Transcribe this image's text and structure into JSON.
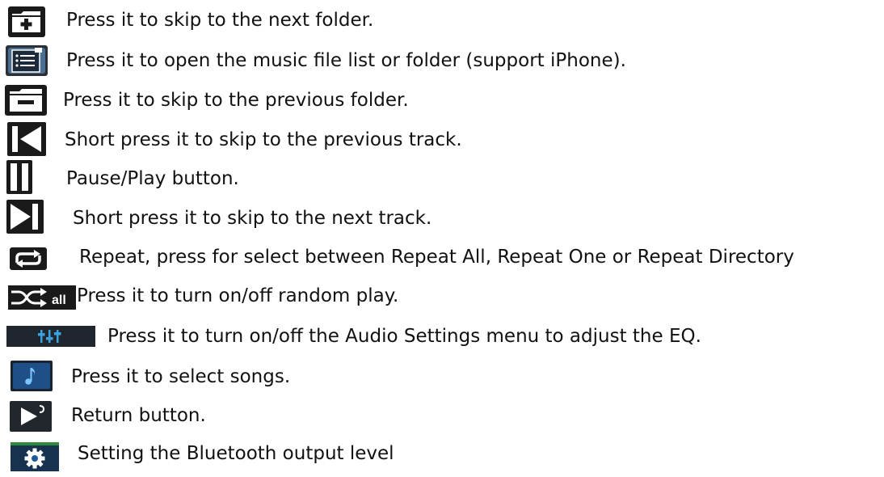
{
  "rows": [
    {
      "icon": "next-folder-icon",
      "text": "Press it to skip to the next folder."
    },
    {
      "icon": "file-list-icon",
      "text": "Press it to open the music file list or folder (support iPhone)."
    },
    {
      "icon": "previous-folder-icon",
      "text": "Press it to skip to the previous folder."
    },
    {
      "icon": "previous-track-icon",
      "text": "Short press it to skip to the previous track."
    },
    {
      "icon": "pause-play-icon",
      "text": "Pause/Play button."
    },
    {
      "icon": "next-track-icon",
      "text": "Short press it to skip to the next track."
    },
    {
      "icon": "repeat-icon",
      "text": "Repeat, press for select between Repeat All, Repeat One or Repeat Directory"
    },
    {
      "icon": "shuffle-all-icon",
      "icon_label": "all",
      "text": "Press it to turn on/off random play."
    },
    {
      "icon": "equalizer-icon",
      "text": "Press it to turn on/off the Audio Settings menu to adjust the EQ."
    },
    {
      "icon": "music-note-icon",
      "text": "Press it to select songs."
    },
    {
      "icon": "return-icon",
      "text": "Return button."
    },
    {
      "icon": "settings-gear-icon",
      "text": "Setting the Bluetooth output level"
    }
  ],
  "colors": {
    "icon_dark": "#1a1a1a",
    "icon_blue": "#1e4f86",
    "icon_accent": "#3aa2e0",
    "text": "#111111"
  }
}
